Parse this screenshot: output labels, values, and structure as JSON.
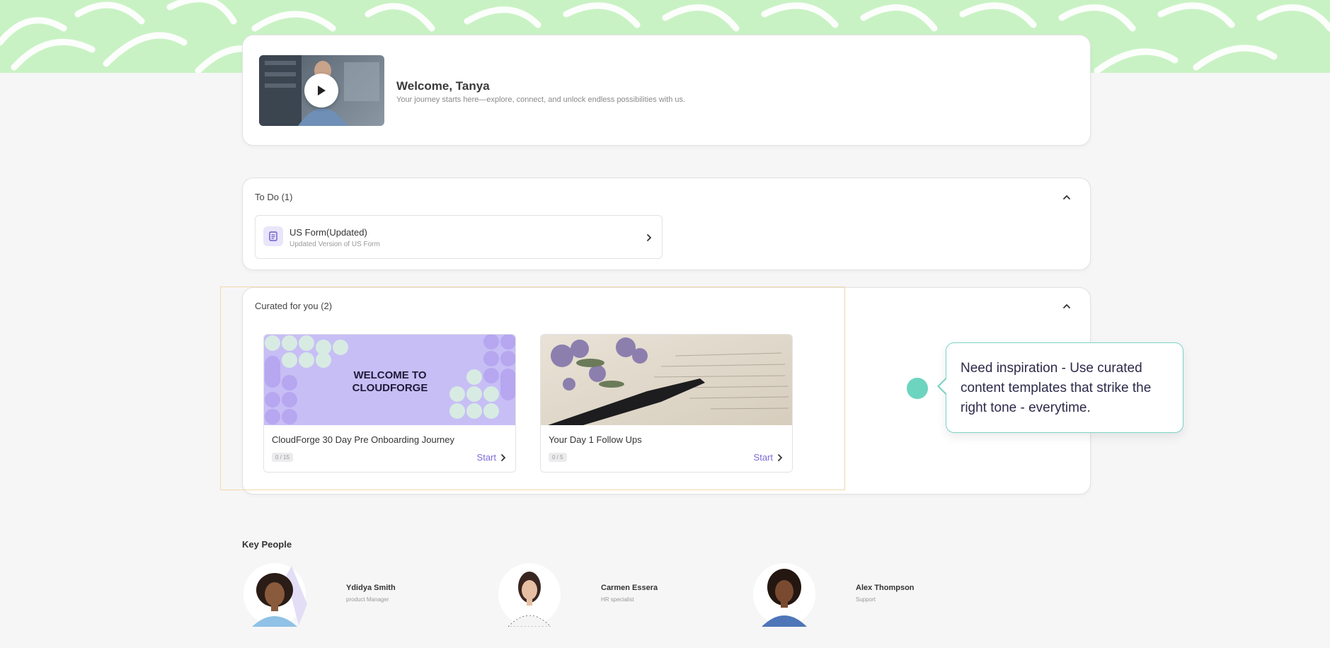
{
  "welcome": {
    "title": "Welcome, Tanya",
    "subtitle": "Your journey starts here—explore, connect, and unlock endless possibilities with us."
  },
  "todo": {
    "title": "To Do (1)",
    "items": [
      {
        "title": "US Form(Updated)",
        "subtitle": "Updated Version of US Form"
      }
    ]
  },
  "curated": {
    "title": "Curated for you (2)",
    "courses": [
      {
        "name": "CloudForge 30 Day Pre Onboarding Journey",
        "progress": "0 / 15",
        "action": "Start",
        "banner_text_1": "WELCOME TO",
        "banner_text_2": "CLOUDFORGE",
        "banner_color": "#c7bef5"
      },
      {
        "name": "Your Day 1 Follow Ups",
        "progress": "0 / 5",
        "action": "Start"
      }
    ]
  },
  "tooltip": {
    "text": "Need inspiration - Use curated content templates that strike the right tone - everytime."
  },
  "key_people": {
    "title": "Key People",
    "people": [
      {
        "name": "Ydidya Smith",
        "role": "product Manager"
      },
      {
        "name": "Carmen Essera",
        "role": "HR specialist"
      },
      {
        "name": "Alex Thompson",
        "role": "Support"
      }
    ]
  },
  "colors": {
    "banner": "#c9f2c4",
    "accent": "#7c6bd6",
    "tooltip_border": "#7cd3c3",
    "tip_dot": "#6dd4bf"
  },
  "icons": [
    "play-icon",
    "chevron-up-icon",
    "document-icon",
    "chevron-right-icon"
  ]
}
